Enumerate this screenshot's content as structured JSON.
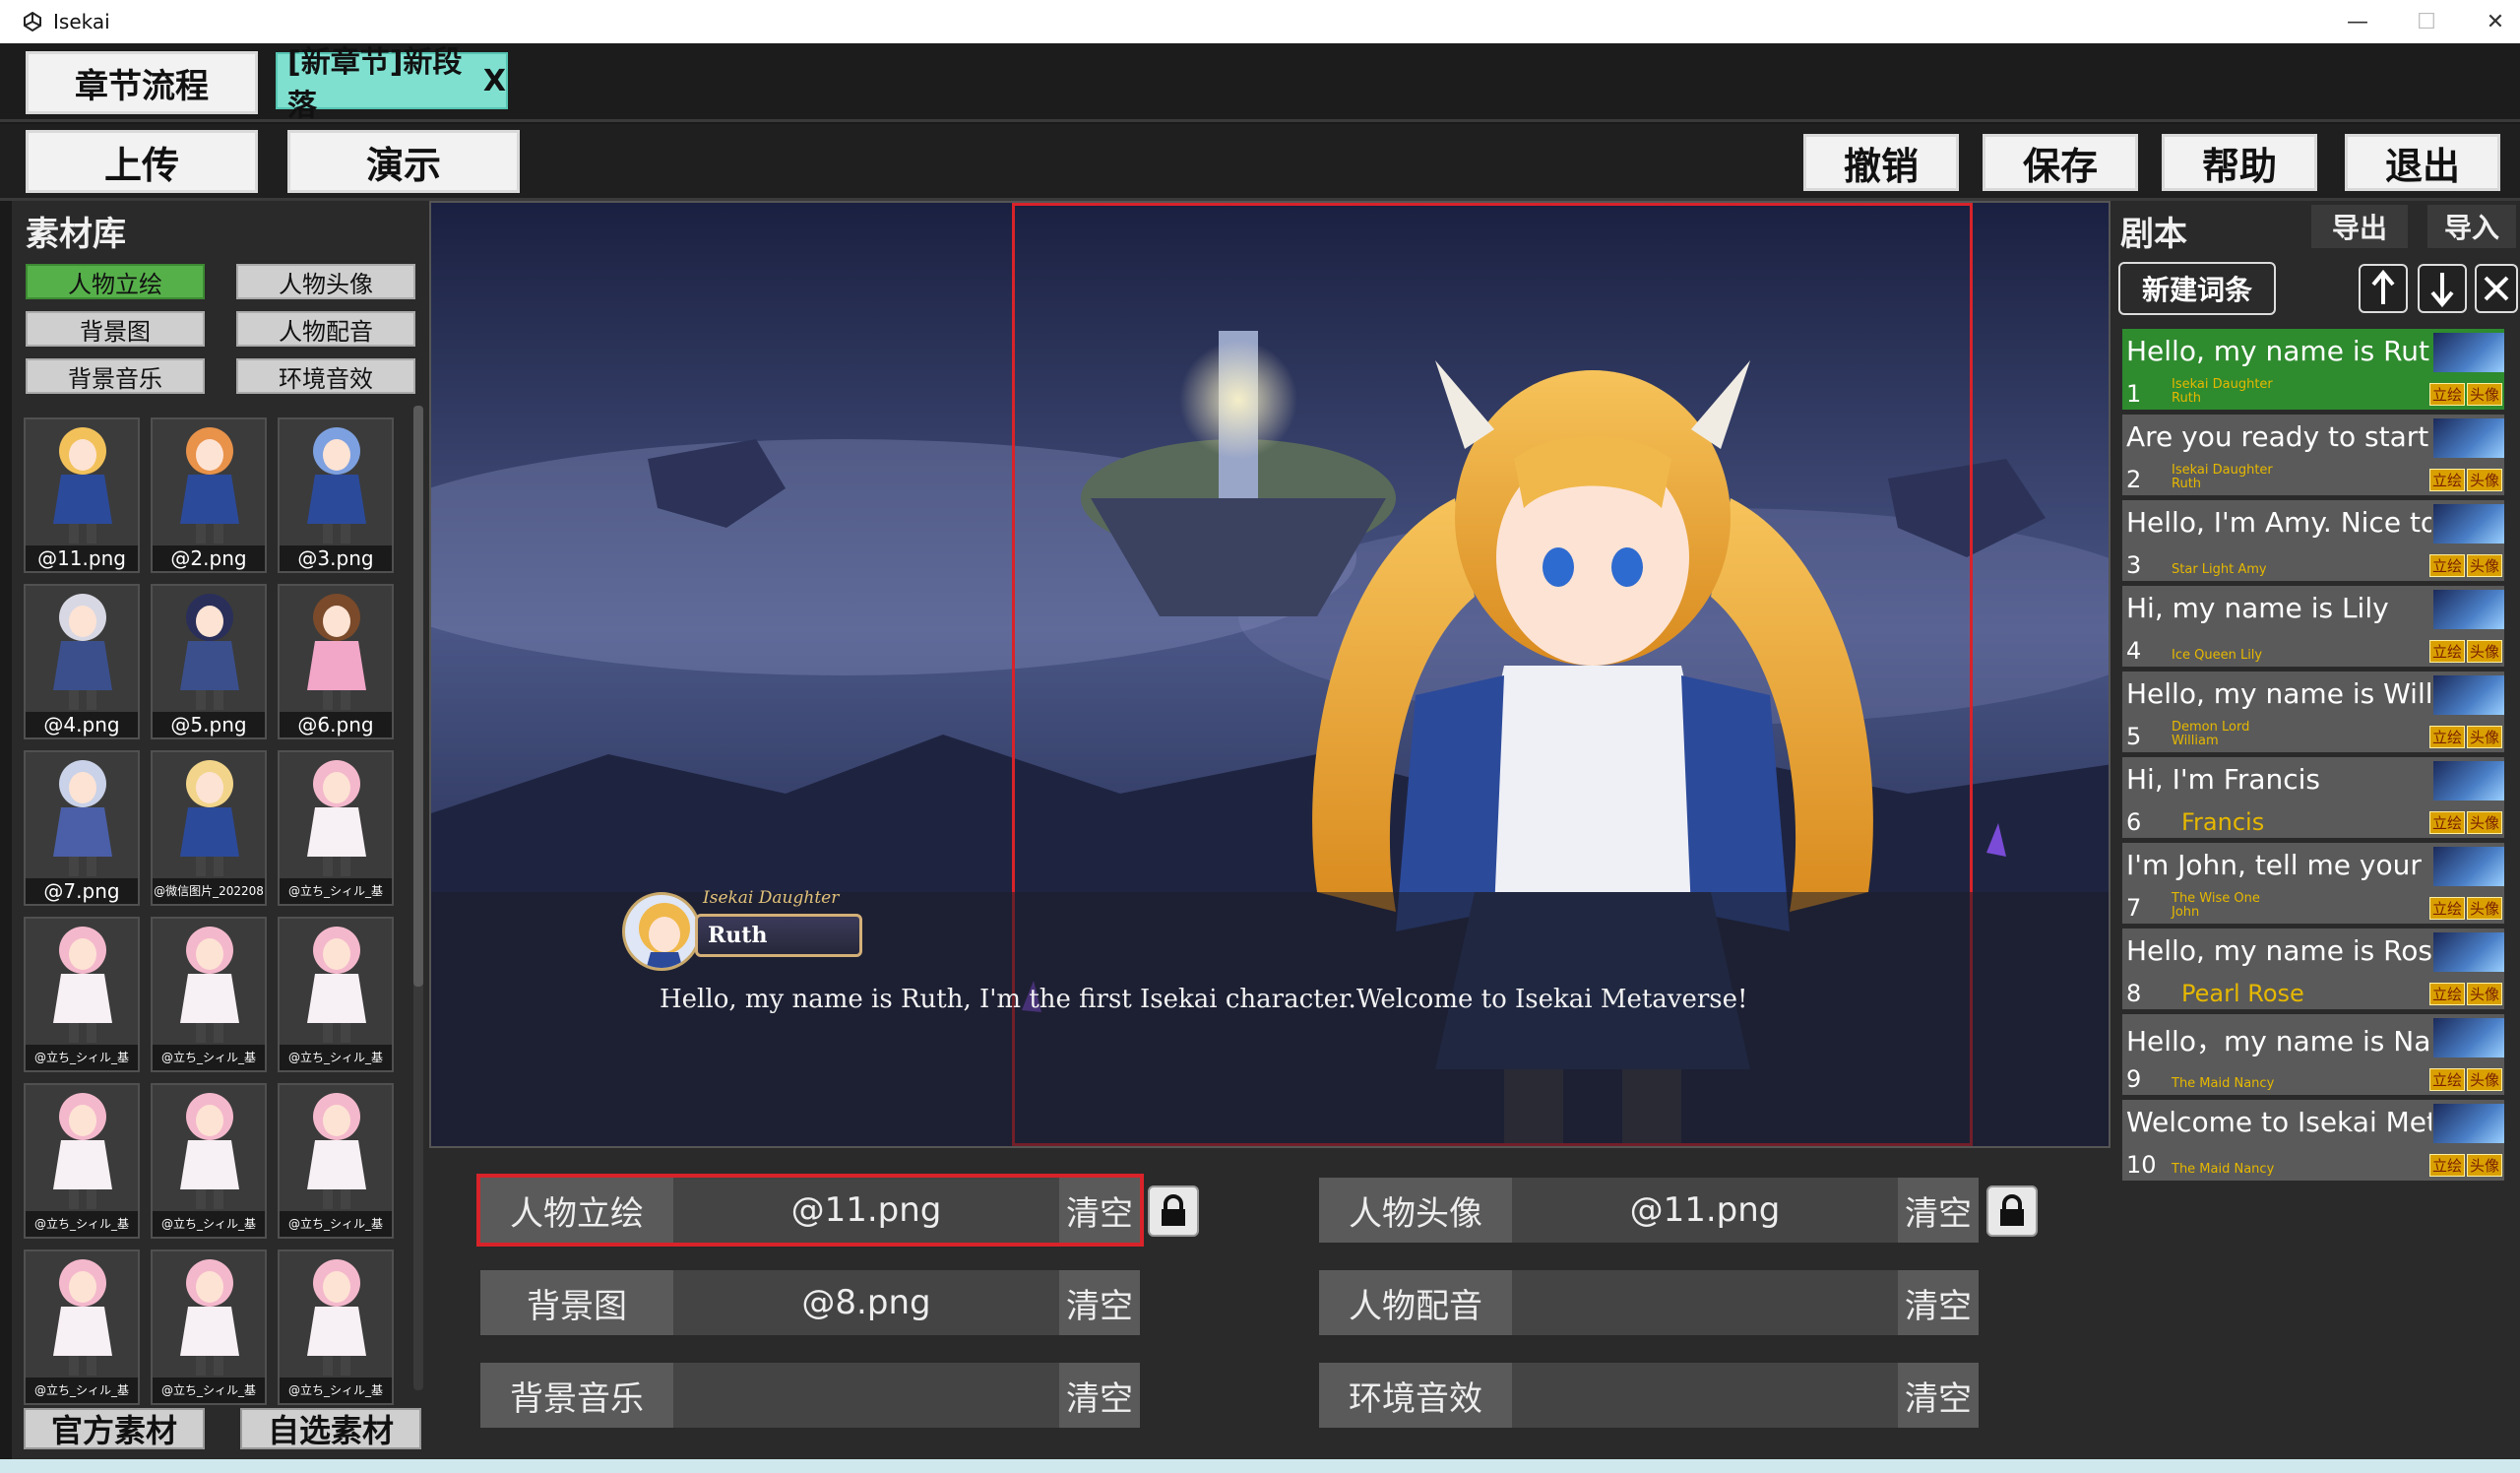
{
  "window": {
    "title": "Isekai",
    "minimize": "—",
    "maximize": "☐",
    "close": "✕"
  },
  "toolbar1": {
    "chapter_flow": "章节流程",
    "tab_label": "[新章节]新段落",
    "tab_close": "X"
  },
  "toolbar2": {
    "upload": "上传",
    "demo": "演示",
    "undo": "撤销",
    "save": "保存",
    "help": "帮助",
    "exit": "退出"
  },
  "assets": {
    "title": "素材库",
    "categories": [
      "人物立绘",
      "人物头像",
      "背景图",
      "人物配音",
      "背景音乐",
      "环境音效"
    ],
    "active_category": "人物立绘",
    "thumbs": [
      "@11.png",
      "@2.png",
      "@3.png",
      "@4.png",
      "@5.png",
      "@6.png",
      "@7.png",
      "@微信图片_202208",
      "@立ち_シィル_基",
      "@立ち_シィル_基",
      "@立ち_シィル_基",
      "@立ち_シィル_基",
      "@立ち_シィル_基",
      "@立ち_シィル_基",
      "@立ち_シィル_基",
      "@立ち_シィル_基",
      "@立ち_シィル_基",
      "@立ち_シィル_基"
    ],
    "official": "官方素材",
    "custom": "自选素材"
  },
  "stage": {
    "speaker_title": "Isekai Daughter",
    "speaker_name": "Ruth",
    "dialog": "Hello, my name is Ruth, I'm the first Isekai character.Welcome to Isekai Metaverse!"
  },
  "fields": {
    "portrait": {
      "label": "人物立绘",
      "value": "@11.png",
      "clear": "清空"
    },
    "avatar": {
      "label": "人物头像",
      "value": "@11.png",
      "clear": "清空"
    },
    "background": {
      "label": "背景图",
      "value": "@8.png",
      "clear": "清空"
    },
    "voice": {
      "label": "人物配音",
      "value": "",
      "clear": "清空"
    },
    "music": {
      "label": "背景音乐",
      "value": "",
      "clear": "清空"
    },
    "ambient": {
      "label": "环境音效",
      "value": "",
      "clear": "清空"
    }
  },
  "script": {
    "title": "剧本",
    "export": "导出",
    "import": "导入",
    "new_entry": "新建词条",
    "tag_portrait": "立绘",
    "tag_avatar": "头像",
    "entries": [
      {
        "num": "1",
        "text": "Hello, my name is Ruth,",
        "role_a": "Isekai Daughter",
        "role_b": "Ruth"
      },
      {
        "num": "2",
        "text": "Are you ready to start yo",
        "role_a": "Isekai Daughter",
        "role_b": "Ruth"
      },
      {
        "num": "3",
        "text": "Hello, I'm Amy. Nice to m",
        "role_a": "Star Light Amy",
        "role_b": ""
      },
      {
        "num": "4",
        "text": "Hi, my name is Lily",
        "role_a": "Ice Queen  Lily",
        "role_b": ""
      },
      {
        "num": "5",
        "text": "Hello, my name is Willian",
        "role_a": "Demon Lord",
        "role_b": "William"
      },
      {
        "num": "6",
        "text": "Hi, I'm Francis",
        "role_a": "Francis",
        "role_b": ""
      },
      {
        "num": "7",
        "text": "I'm John, tell me your na",
        "role_a": "The Wise One",
        "role_b": "John"
      },
      {
        "num": "8",
        "text": "Hello, my name is Rose",
        "role_a": "Pearl  Rose",
        "role_b": ""
      },
      {
        "num": "9",
        "text": "Hello，my name is Nanc",
        "role_a": "The Maid  Nancy",
        "role_b": ""
      },
      {
        "num": "10",
        "text": "Welcome to Isekai Metav",
        "role_a": "The Maid  Nancy",
        "role_b": ""
      }
    ]
  }
}
